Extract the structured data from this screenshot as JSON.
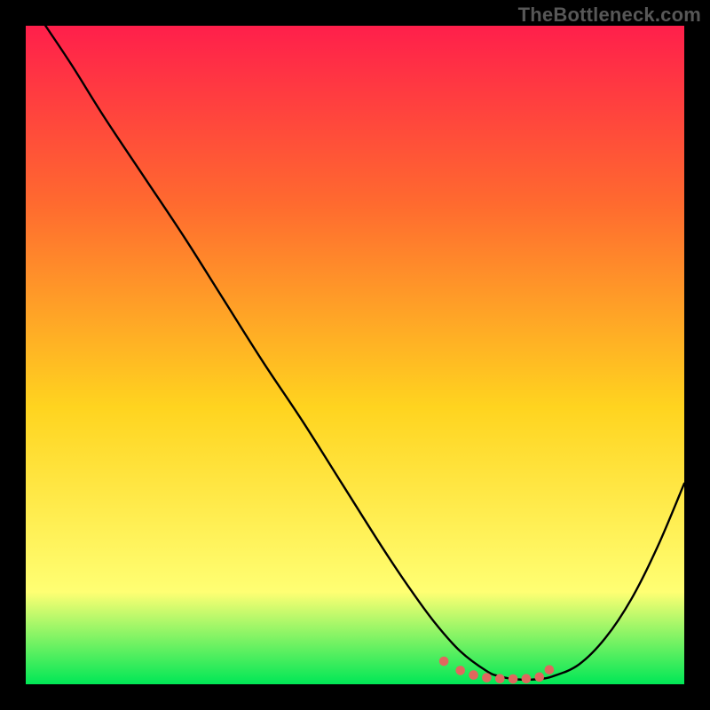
{
  "watermark": "TheBottleneck.com",
  "colors": {
    "background": "#000000",
    "gradient_top": "#ff1f4b",
    "gradient_mid_upper": "#ff6a2f",
    "gradient_mid": "#ffd41f",
    "gradient_mid_lower": "#ffff73",
    "gradient_bottom": "#00e756",
    "curve": "#000000",
    "marker": "#e0675e"
  },
  "chart_data": {
    "type": "line",
    "title": "",
    "xlabel": "",
    "ylabel": "",
    "xlim": [
      0,
      100
    ],
    "ylim": [
      0,
      100
    ],
    "grid": false,
    "x": [
      3,
      7,
      12,
      18,
      24,
      30,
      36,
      42,
      48,
      54,
      58,
      62,
      66,
      70,
      72,
      74,
      76,
      78,
      80,
      84,
      88,
      92,
      96,
      100
    ],
    "y": [
      100,
      94,
      86,
      77,
      68,
      58.5,
      49,
      40,
      30.5,
      21,
      15,
      9.5,
      5,
      2,
      1.2,
      0.8,
      0.7,
      0.8,
      1.2,
      3,
      7,
      13,
      21,
      30.5
    ],
    "markers": {
      "x": [
        63.5,
        66,
        68,
        70,
        72,
        74,
        76,
        78,
        79.5
      ],
      "y": [
        3.5,
        2.1,
        1.4,
        1.0,
        0.85,
        0.8,
        0.85,
        1.1,
        2.2
      ]
    },
    "legend": null
  }
}
